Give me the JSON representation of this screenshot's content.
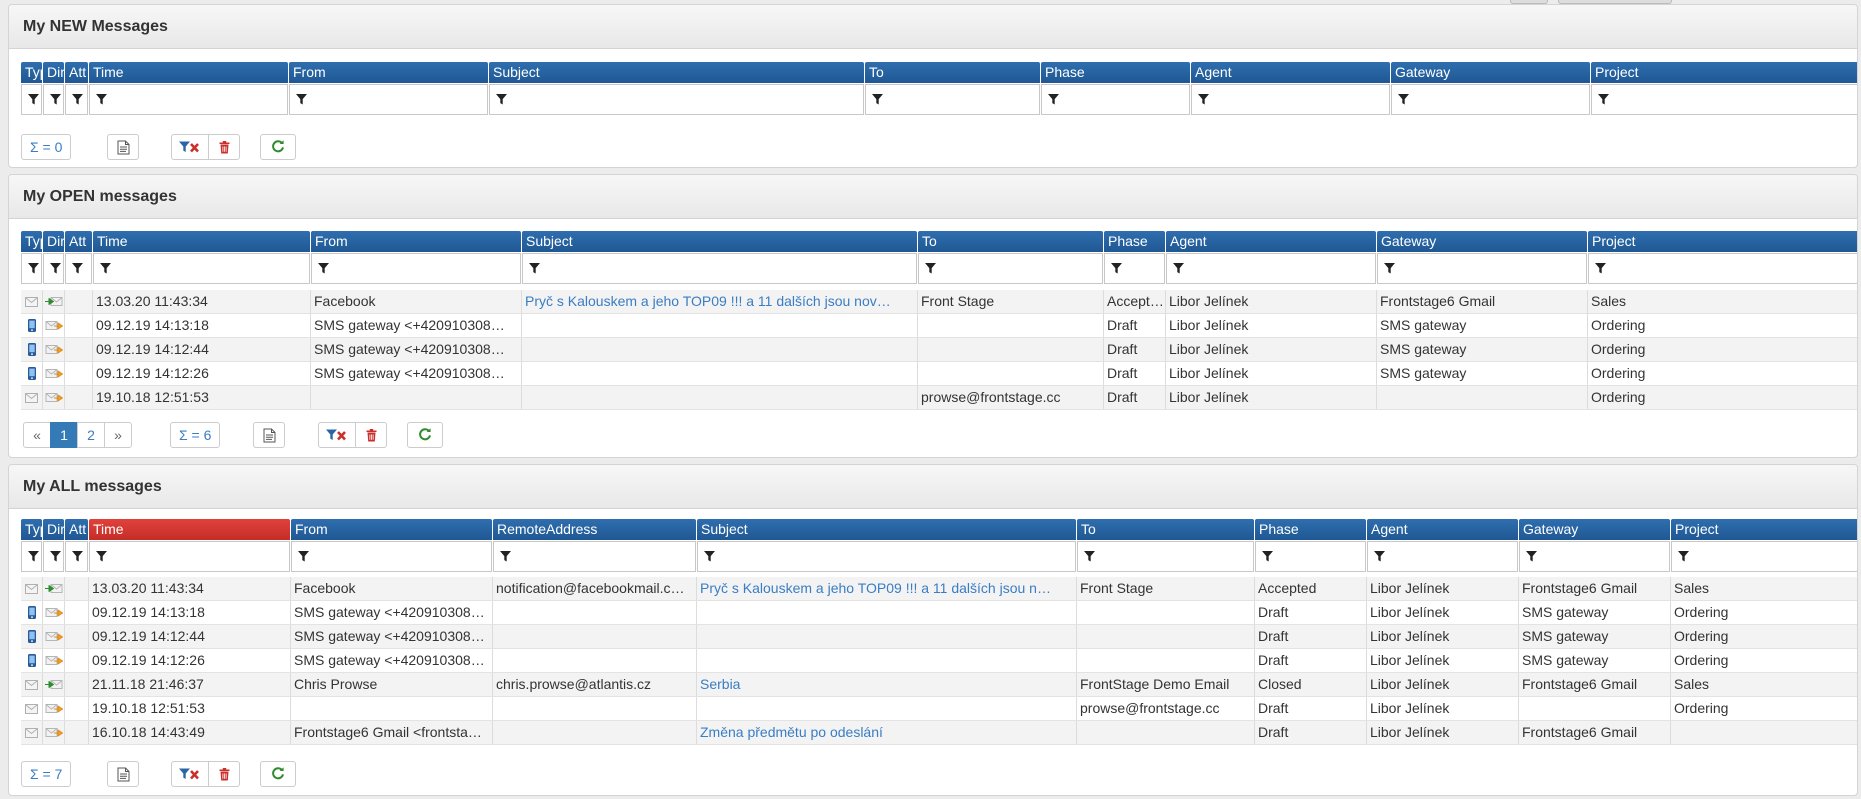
{
  "panels": {
    "new": {
      "title": "My NEW Messages",
      "columns": [
        "Type",
        "Direction",
        "Att",
        "Time",
        "From",
        "Subject",
        "To",
        "Phase",
        "Agent",
        "Gateway",
        "Project"
      ],
      "sum": "Σ = 0"
    },
    "open": {
      "title": "My OPEN messages",
      "columns": [
        "Type",
        "Direction",
        "Att",
        "Time",
        "From",
        "Subject",
        "To",
        "Phase",
        "Agent",
        "Gateway",
        "Project"
      ],
      "rows": [
        {
          "time": "13.03.20 11:43:34",
          "from": "Facebook",
          "subject": "Pryč s Kalouskem a jeho TOP09 !!! a 11 dalších jsou nov…",
          "to": "Front Stage",
          "phase": "Accepted",
          "agent": "Libor Jelínek",
          "gateway": "Frontstage6 Gmail",
          "project": "Sales"
        },
        {
          "time": "09.12.19 14:13:18",
          "from": "SMS gateway <+420910308…",
          "subject": "",
          "to": "",
          "phase": "Draft",
          "agent": "Libor Jelínek",
          "gateway": "SMS gateway",
          "project": "Ordering"
        },
        {
          "time": "09.12.19 14:12:44",
          "from": "SMS gateway <+420910308…",
          "subject": "",
          "to": "",
          "phase": "Draft",
          "agent": "Libor Jelínek",
          "gateway": "SMS gateway",
          "project": "Ordering"
        },
        {
          "time": "09.12.19 14:12:26",
          "from": "SMS gateway <+420910308…",
          "subject": "",
          "to": "",
          "phase": "Draft",
          "agent": "Libor Jelínek",
          "gateway": "SMS gateway",
          "project": "Ordering"
        },
        {
          "time": "19.10.18 12:51:53",
          "from": "",
          "subject": "",
          "to": "prowse@frontstage.cc",
          "phase": "Draft",
          "agent": "Libor Jelínek",
          "gateway": "",
          "project": "Ordering"
        }
      ],
      "pager": {
        "prev": "«",
        "pages": [
          "1",
          "2"
        ],
        "next": "»"
      },
      "sum": "Σ = 6"
    },
    "all": {
      "title": "My ALL messages",
      "columns": [
        "Type",
        "Direction",
        "Att",
        "Time",
        "From",
        "RemoteAddress",
        "Subject",
        "To",
        "Phase",
        "Agent",
        "Gateway",
        "Project"
      ],
      "rows": [
        {
          "time": "13.03.20 11:43:34",
          "from": "Facebook",
          "remote": "notification@facebookmail.c…",
          "subject": "Pryč s Kalouskem a jeho TOP09 !!! a 11 dalších jsou n…",
          "to": "Front Stage",
          "phase": "Accepted",
          "agent": "Libor Jelínek",
          "gateway": "Frontstage6 Gmail",
          "project": "Sales"
        },
        {
          "time": "09.12.19 14:13:18",
          "from": "SMS gateway <+420910308…",
          "remote": "",
          "subject": "",
          "to": "",
          "phase": "Draft",
          "agent": "Libor Jelínek",
          "gateway": "SMS gateway",
          "project": "Ordering"
        },
        {
          "time": "09.12.19 14:12:44",
          "from": "SMS gateway <+420910308…",
          "remote": "",
          "subject": "",
          "to": "",
          "phase": "Draft",
          "agent": "Libor Jelínek",
          "gateway": "SMS gateway",
          "project": "Ordering"
        },
        {
          "time": "09.12.19 14:12:26",
          "from": "SMS gateway <+420910308…",
          "remote": "",
          "subject": "",
          "to": "",
          "phase": "Draft",
          "agent": "Libor Jelínek",
          "gateway": "SMS gateway",
          "project": "Ordering"
        },
        {
          "time": "21.11.18 21:46:37",
          "from": "Chris Prowse",
          "remote": "chris.prowse@atlantis.cz",
          "subject": "Serbia",
          "to": "FrontStage Demo Email",
          "phase": "Closed",
          "agent": "Libor Jelínek",
          "gateway": "Frontstage6 Gmail",
          "project": "Sales"
        },
        {
          "time": "19.10.18 12:51:53",
          "from": "",
          "remote": "",
          "subject": "",
          "to": "prowse@frontstage.cc",
          "phase": "Draft",
          "agent": "Libor Jelínek",
          "gateway": "",
          "project": "Ordering"
        },
        {
          "time": "16.10.18 14:43:49",
          "from": "Frontstage6 Gmail <frontsta…",
          "remote": "",
          "subject": "Změna předmětu po odeslání",
          "to": "",
          "phase": "Draft",
          "agent": "Libor Jelínek",
          "gateway": "Frontstage6 Gmail",
          "project": ""
        }
      ],
      "sum": "Σ = 7"
    }
  },
  "icons": {
    "filter": "filter-icon",
    "doc": "document-icon",
    "clear": "filter-clear-icon",
    "trash": "trash-icon",
    "refresh": "refresh-icon",
    "mail": "envelope-icon",
    "sms": "mobile-phone-icon",
    "in": "incoming-arrow-icon",
    "out": "outgoing-arrow-icon"
  },
  "colors": {
    "header": "#2a66a5",
    "sorted": "#d8372f",
    "link": "#3a7dc4",
    "trash": "#c9302c",
    "refresh": "#2e8b2e"
  }
}
